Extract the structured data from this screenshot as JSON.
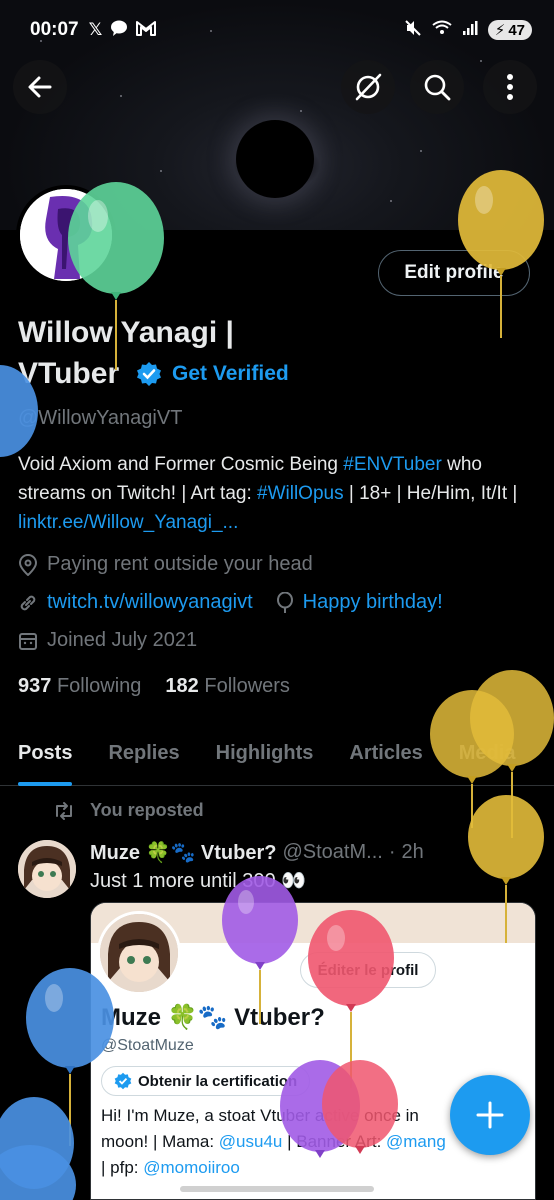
{
  "status_bar": {
    "time": "00:07",
    "battery": "47",
    "left_icons": [
      "x-logo-icon",
      "chat-bubble-icon",
      "gmail-icon"
    ],
    "right_icons": [
      "mute-icon",
      "wifi-icon",
      "signal-icon",
      "battery-icon"
    ]
  },
  "header": {
    "back_icon": "arrow-left-icon",
    "grok_icon": "grok-icon",
    "search_icon": "search-icon",
    "more_icon": "more-vertical-icon"
  },
  "profile": {
    "name": "Willow Yanagi | VTuber",
    "name_line1": "Willow Yanagi |",
    "name_line2": "VTuber",
    "get_verified": "Get Verified",
    "handle": "@WillowYanagiVT",
    "bio_part1": "Void Axiom and Former Cosmic Being ",
    "bio_tag1": "#ENVTuber",
    "bio_part2": " who streams on Twitch! | Art tag: ",
    "bio_tag2": "#WillOpus",
    "bio_part3": " | 18+ | He/Him, It/It | ",
    "bio_link": "linktr.ee/Willow_Yanagi_...",
    "location": "Paying rent outside your head",
    "website": "twitch.tv/willowyanagivt",
    "birthday": "Happy birthday!",
    "joined": "Joined July 2021",
    "following_count": "937",
    "following_label": "Following",
    "followers_count": "182",
    "followers_label": "Followers",
    "edit_profile": "Edit profile"
  },
  "tabs": [
    "Posts",
    "Replies",
    "Highlights",
    "Articles",
    "Media"
  ],
  "post": {
    "repost_label": "You reposted",
    "author_name": "Muze 🍀🐾 Vtuber?",
    "author_handle": "@StoatM...",
    "separator": "·",
    "time": "2h",
    "text": "Just 1 more until 300 👀",
    "embed": {
      "edit_button": "Éditer le profil",
      "name": "Muze 🍀🐾 Vtuber?",
      "handle": "@StoatMuze",
      "cert_button": "Obtenir la certification",
      "bio_line1": "Hi! I'm Muze, a stoat Vtuber active once in",
      "bio_line2_a": "moon! | Mama: ",
      "bio_line2_link1": "@usu4u",
      "bio_line2_b": " | Banner Art: ",
      "bio_line2_link2": "@mang",
      "bio_line3_a": "| pfp: ",
      "bio_line3_link": "@momoiiroo"
    }
  },
  "fab": {
    "icon": "plus-icon"
  },
  "balloon_colors": {
    "green": "#5ed59a",
    "yellow": "#e2bb3a",
    "blue": "#4a90e2",
    "purple": "#a15be6",
    "pink": "#f0566f"
  },
  "accent": "#1d9bf0"
}
